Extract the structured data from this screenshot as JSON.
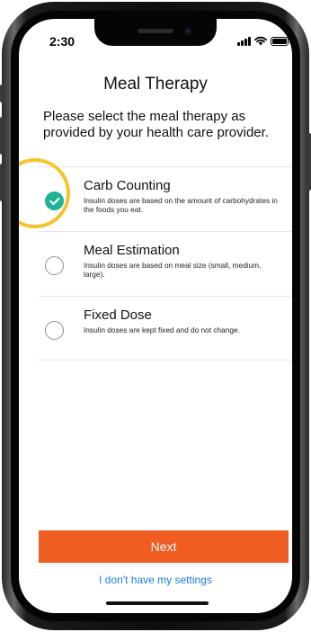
{
  "status_bar": {
    "time": "2:30"
  },
  "screen": {
    "title": "Meal Therapy",
    "instruction": "Please select the meal therapy as provided by your health care provider."
  },
  "options": [
    {
      "title": "Carb Counting",
      "description": "Insulin doses are based on the amount of carbohydrates in the foods you eat.",
      "selected": true
    },
    {
      "title": "Meal Estimation",
      "description": "Insulin doses are based on meal size (small, medium, large).",
      "selected": false
    },
    {
      "title": "Fixed Dose",
      "description": "Insulin doses are kept fixed and do not change.",
      "selected": false
    }
  ],
  "actions": {
    "next_label": "Next",
    "no_settings_label": "I don't have my settings"
  },
  "colors": {
    "accent_orange": "#ef5d22",
    "selected_green": "#1fb295",
    "link_blue": "#1a7de0",
    "highlight_yellow": "#f5c42c"
  },
  "icons": [
    "signal-icon",
    "wifi-icon",
    "battery-icon",
    "checkmark-icon"
  ]
}
